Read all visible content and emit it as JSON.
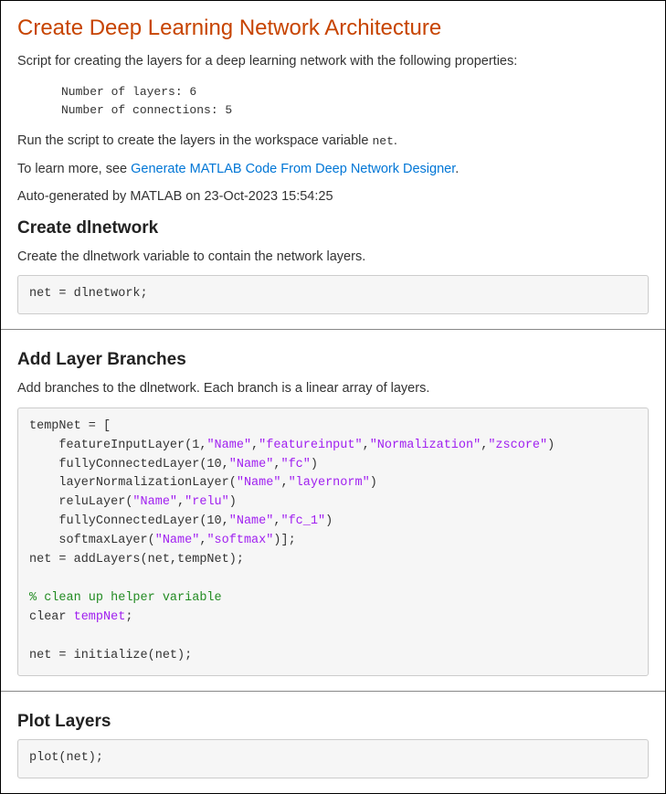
{
  "header": {
    "title": "Create Deep Learning Network Architecture",
    "intro": "Script for creating the layers for a deep learning network with the following properties:",
    "props_line1": "Number of layers: 6",
    "props_line2": "Number of connections: 5",
    "run_text_pre": "Run the script to create the layers in the workspace variable ",
    "run_code": "net",
    "run_text_post": ".",
    "learn_pre": "To learn more, see ",
    "learn_link": "Generate MATLAB Code From Deep Network Designer",
    "learn_post": ".",
    "autogen": "Auto-generated by MATLAB on 23-Oct-2023 15:54:25"
  },
  "sec1": {
    "heading": "Create dlnetwork",
    "desc": "Create the dlnetwork variable to contain the network layers.",
    "code": "net = dlnetwork;"
  },
  "sec2": {
    "heading": "Add Layer Branches",
    "desc": "Add branches to the dlnetwork. Each branch is a linear array of layers.",
    "code_plain": "tempNet = [\n    featureInputLayer(1,\"Name\",\"featureinput\",\"Normalization\",\"zscore\")\n    fullyConnectedLayer(10,\"Name\",\"fc\")\n    layerNormalizationLayer(\"Name\",\"layernorm\")\n    reluLayer(\"Name\",\"relu\")\n    fullyConnectedLayer(10,\"Name\",\"fc_1\")\n    softmaxLayer(\"Name\",\"softmax\")];\nnet = addLayers(net,tempNet);\n\n% clean up helper variable\nclear tempNet;\n\nnet = initialize(net);",
    "code_lines": [
      [
        {
          "t": "tempNet = ["
        }
      ],
      [
        {
          "t": "    featureInputLayer(1,"
        },
        {
          "t": "\"Name\"",
          "c": "str"
        },
        {
          "t": ","
        },
        {
          "t": "\"featureinput\"",
          "c": "str"
        },
        {
          "t": ","
        },
        {
          "t": "\"Normalization\"",
          "c": "str"
        },
        {
          "t": ","
        },
        {
          "t": "\"zscore\"",
          "c": "str"
        },
        {
          "t": ")"
        }
      ],
      [
        {
          "t": "    fullyConnectedLayer(10,"
        },
        {
          "t": "\"Name\"",
          "c": "str"
        },
        {
          "t": ","
        },
        {
          "t": "\"fc\"",
          "c": "str"
        },
        {
          "t": ")"
        }
      ],
      [
        {
          "t": "    layerNormalizationLayer("
        },
        {
          "t": "\"Name\"",
          "c": "str"
        },
        {
          "t": ","
        },
        {
          "t": "\"layernorm\"",
          "c": "str"
        },
        {
          "t": ")"
        }
      ],
      [
        {
          "t": "    reluLayer("
        },
        {
          "t": "\"Name\"",
          "c": "str"
        },
        {
          "t": ","
        },
        {
          "t": "\"relu\"",
          "c": "str"
        },
        {
          "t": ")"
        }
      ],
      [
        {
          "t": "    fullyConnectedLayer(10,"
        },
        {
          "t": "\"Name\"",
          "c": "str"
        },
        {
          "t": ","
        },
        {
          "t": "\"fc_1\"",
          "c": "str"
        },
        {
          "t": ")"
        }
      ],
      [
        {
          "t": "    softmaxLayer("
        },
        {
          "t": "\"Name\"",
          "c": "str"
        },
        {
          "t": ","
        },
        {
          "t": "\"softmax\"",
          "c": "str"
        },
        {
          "t": ")];"
        }
      ],
      [
        {
          "t": "net = addLayers(net,tempNet);"
        }
      ],
      [
        {
          "t": ""
        }
      ],
      [
        {
          "t": "% clean up helper variable",
          "c": "cmt"
        }
      ],
      [
        {
          "t": "clear "
        },
        {
          "t": "tempNet",
          "c": "str"
        },
        {
          "t": ";"
        }
      ],
      [
        {
          "t": ""
        }
      ],
      [
        {
          "t": "net = initialize(net);"
        }
      ]
    ]
  },
  "sec3": {
    "heading": "Plot Layers",
    "code": "plot(net);"
  }
}
